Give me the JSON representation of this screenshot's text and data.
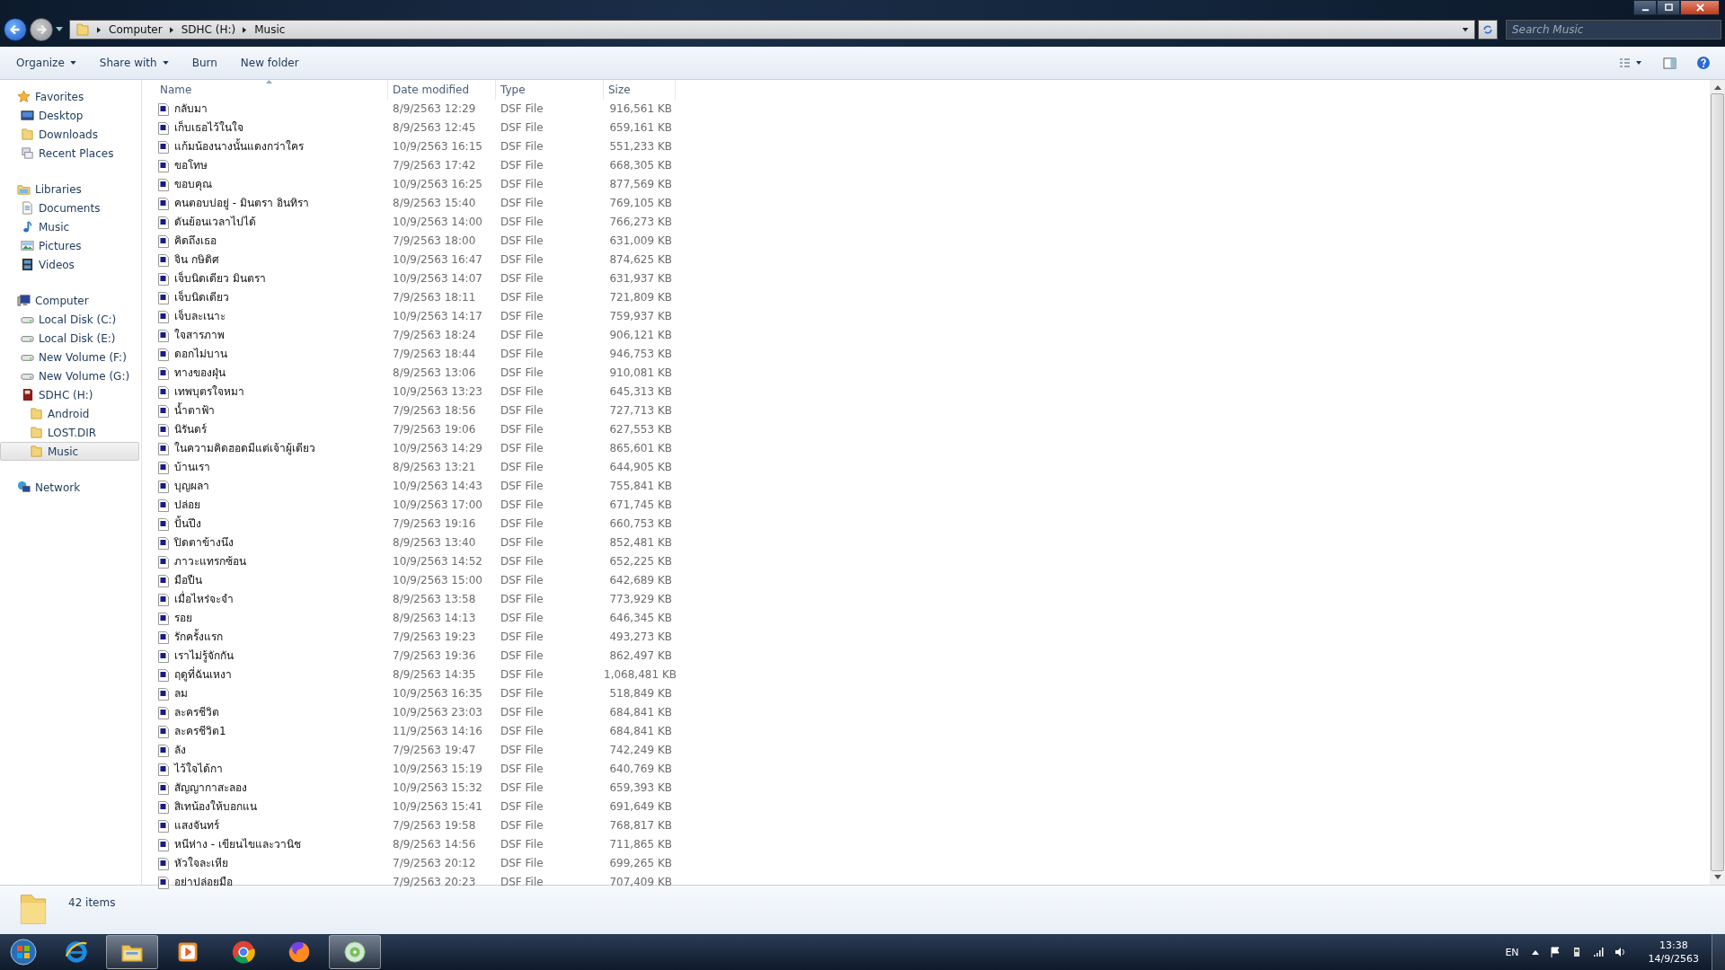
{
  "address_bar": {
    "path": [
      "Computer",
      "SDHC (H:)",
      "Music"
    ]
  },
  "search": {
    "placeholder": "Search Music"
  },
  "toolbar": {
    "buttons": [
      {
        "label": "Organize",
        "dropdown": true
      },
      {
        "label": "Share with",
        "dropdown": true
      },
      {
        "label": "Burn",
        "dropdown": false
      },
      {
        "label": "New folder",
        "dropdown": false
      }
    ]
  },
  "sidebar": {
    "groups": [
      {
        "label": "Favorites",
        "children": [
          {
            "label": "Desktop",
            "selected": false
          },
          {
            "label": "Downloads",
            "selected": false
          },
          {
            "label": "Recent Places",
            "selected": false
          }
        ]
      },
      {
        "label": "Libraries",
        "children": [
          {
            "label": "Documents",
            "selected": false
          },
          {
            "label": "Music",
            "selected": false
          },
          {
            "label": "Pictures",
            "selected": false
          },
          {
            "label": "Videos",
            "selected": false
          }
        ]
      },
      {
        "label": "Computer",
        "children": [
          {
            "label": "Local Disk (C:)",
            "selected": false
          },
          {
            "label": "Local Disk (E:)",
            "selected": false
          },
          {
            "label": "New Volume (F:)",
            "selected": false
          },
          {
            "label": "New Volume (G:)",
            "selected": false
          },
          {
            "label": "SDHC (H:)",
            "selected": false,
            "children": [
              {
                "label": "Android",
                "selected": false
              },
              {
                "label": "LOST.DIR",
                "selected": false
              },
              {
                "label": "Music",
                "selected": true
              }
            ]
          }
        ]
      },
      {
        "label": "Network"
      }
    ]
  },
  "table": {
    "columns": [
      "Name",
      "Date modified",
      "Type",
      "Size"
    ],
    "rows": [
      {
        "name": "กลับมา",
        "date": "8/9/2563 12:29",
        "type": "DSF File",
        "size": "916,561 KB"
      },
      {
        "name": "เก็บเธอไว้ในใจ",
        "date": "8/9/2563 12:45",
        "type": "DSF File",
        "size": "659,161 KB"
      },
      {
        "name": "แก้มน้องนางนั้นแดงกว่าใคร",
        "date": "10/9/2563 16:15",
        "type": "DSF File",
        "size": "551,233 KB"
      },
      {
        "name": "ขอโทษ",
        "date": "7/9/2563 17:42",
        "type": "DSF File",
        "size": "668,305 KB"
      },
      {
        "name": "ขอบคุณ",
        "date": "10/9/2563 16:25",
        "type": "DSF File",
        "size": "877,569 KB"
      },
      {
        "name": "คนตอบบ่อยู่ - มินตรา อินทิรา",
        "date": "8/9/2563 15:40",
        "type": "DSF File",
        "size": "769,105 KB"
      },
      {
        "name": "ดันย้อนเวลาไปได้",
        "date": "10/9/2563 14:00",
        "type": "DSF File",
        "size": "766,273 KB"
      },
      {
        "name": "คิดถึงเธอ",
        "date": "7/9/2563 18:00",
        "type": "DSF File",
        "size": "631,009 KB"
      },
      {
        "name": "จิน กษิดิศ",
        "date": "10/9/2563 16:47",
        "type": "DSF File",
        "size": "874,625 KB"
      },
      {
        "name": "เจ็บนิดเดียว มินตรา",
        "date": "10/9/2563 14:07",
        "type": "DSF File",
        "size": "631,937 KB"
      },
      {
        "name": "เจ็บนิดเดียว",
        "date": "7/9/2563 18:11",
        "type": "DSF File",
        "size": "721,809 KB"
      },
      {
        "name": "เจ็บละเนาะ",
        "date": "10/9/2563 14:17",
        "type": "DSF File",
        "size": "759,937 KB"
      },
      {
        "name": "ใจสารภาพ",
        "date": "7/9/2563 18:24",
        "type": "DSF File",
        "size": "906,121 KB"
      },
      {
        "name": "ดอกไม่บาน",
        "date": "7/9/2563 18:44",
        "type": "DSF File",
        "size": "946,753 KB"
      },
      {
        "name": "ทางของฝุ่น",
        "date": "8/9/2563 13:06",
        "type": "DSF File",
        "size": "910,081 KB"
      },
      {
        "name": "เทพบุตรใจหมา",
        "date": "10/9/2563 13:23",
        "type": "DSF File",
        "size": "645,313 KB"
      },
      {
        "name": "น้ำตาฟ้า",
        "date": "7/9/2563 18:56",
        "type": "DSF File",
        "size": "727,713 KB"
      },
      {
        "name": "นิรันดร์",
        "date": "7/9/2563 19:06",
        "type": "DSF File",
        "size": "627,553 KB"
      },
      {
        "name": "ในความคิดฮอดมีแต่เจ้าผู้เดียว",
        "date": "10/9/2563 14:29",
        "type": "DSF File",
        "size": "865,601 KB"
      },
      {
        "name": "บ้านเรา",
        "date": "8/9/2563 13:21",
        "type": "DSF File",
        "size": "644,905 KB"
      },
      {
        "name": "บุญผลา",
        "date": "10/9/2563 14:43",
        "type": "DSF File",
        "size": "755,841 KB"
      },
      {
        "name": "ปล่อย",
        "date": "10/9/2563 17:00",
        "type": "DSF File",
        "size": "671,745 KB"
      },
      {
        "name": "ปั้นปึง",
        "date": "7/9/2563 19:16",
        "type": "DSF File",
        "size": "660,753 KB"
      },
      {
        "name": "ปิดตาข้างนึง",
        "date": "8/9/2563 13:40",
        "type": "DSF File",
        "size": "852,481 KB"
      },
      {
        "name": "ภาวะแทรกซ้อน",
        "date": "10/9/2563 14:52",
        "type": "DSF File",
        "size": "652,225 KB"
      },
      {
        "name": "มือปืน",
        "date": "10/9/2563 15:00",
        "type": "DSF File",
        "size": "642,689 KB"
      },
      {
        "name": "เมื่อไหร่จะจำ",
        "date": "8/9/2563 13:58",
        "type": "DSF File",
        "size": "773,929 KB"
      },
      {
        "name": "รอย",
        "date": "8/9/2563 14:13",
        "type": "DSF File",
        "size": "646,345 KB"
      },
      {
        "name": "รักครั้งแรก",
        "date": "7/9/2563 19:23",
        "type": "DSF File",
        "size": "493,273 KB"
      },
      {
        "name": "เราไม่รู้จักกัน",
        "date": "7/9/2563 19:36",
        "type": "DSF File",
        "size": "862,497 KB"
      },
      {
        "name": "ฤดูที่ฉันเหงา",
        "date": "8/9/2563 14:35",
        "type": "DSF File",
        "size": "1,068,481 KB"
      },
      {
        "name": "ลม",
        "date": "10/9/2563 16:35",
        "type": "DSF File",
        "size": "518,849 KB"
      },
      {
        "name": "ละครชีวิต",
        "date": "10/9/2563 23:03",
        "type": "DSF File",
        "size": "684,841 KB"
      },
      {
        "name": "ละครชีวิต1",
        "date": "11/9/2563 14:16",
        "type": "DSF File",
        "size": "684,841 KB"
      },
      {
        "name": "ลัง",
        "date": "7/9/2563 19:47",
        "type": "DSF File",
        "size": "742,249 KB"
      },
      {
        "name": "ไว้ใจได้กา",
        "date": "10/9/2563 15:19",
        "type": "DSF File",
        "size": "640,769 KB"
      },
      {
        "name": "สัญญากาสะลอง",
        "date": "10/9/2563 15:32",
        "type": "DSF File",
        "size": "659,393 KB"
      },
      {
        "name": "สิเทน้องให้บอกแน",
        "date": "10/9/2563 15:41",
        "type": "DSF File",
        "size": "691,649 KB"
      },
      {
        "name": "แสงจันทร์",
        "date": "7/9/2563 19:58",
        "type": "DSF File",
        "size": "768,817 KB"
      },
      {
        "name": "หนีห่าง - เขียนไขและวานิช",
        "date": "8/9/2563 14:56",
        "type": "DSF File",
        "size": "711,865 KB"
      },
      {
        "name": "หัวใจละเหีย",
        "date": "7/9/2563 20:12",
        "type": "DSF File",
        "size": "699,265 KB"
      },
      {
        "name": "อย่าปล่อยมือ",
        "date": "7/9/2563 20:23",
        "type": "DSF File",
        "size": "707,409 KB"
      }
    ]
  },
  "status_bar": {
    "text": "42 items"
  },
  "taskbar": {
    "apps": [
      {
        "kind": "browser-e",
        "active": false
      },
      {
        "kind": "folders",
        "active": true
      },
      {
        "kind": "player",
        "active": false
      },
      {
        "kind": "chrome",
        "active": false
      },
      {
        "kind": "firefox",
        "active": false
      },
      {
        "kind": "disc",
        "active": true
      }
    ],
    "language": "EN",
    "time": "13:38",
    "date": "14/9/2563"
  }
}
